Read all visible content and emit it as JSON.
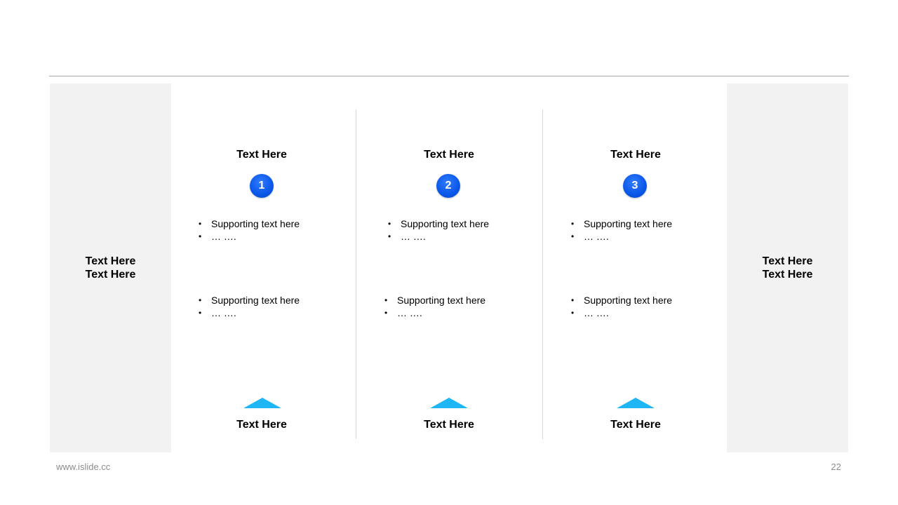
{
  "left_panel": {
    "line1": "Text Here",
    "line2": "Text Here"
  },
  "right_panel": {
    "line1": "Text Here",
    "line2": "Text Here"
  },
  "columns": [
    {
      "title": "Text Here",
      "number": "1",
      "group1": [
        "Supporting  text here",
        "… …."
      ],
      "group2": [
        "Supporting  text here",
        "… …."
      ],
      "footer": "Text Here"
    },
    {
      "title": "Text Here",
      "number": "2",
      "group1": [
        "Supporting  text here",
        "… …."
      ],
      "group2": [
        "Supporting  text here",
        "… …."
      ],
      "footer": "Text Here"
    },
    {
      "title": "Text Here",
      "number": "3",
      "group1": [
        "Supporting  text here",
        "… …."
      ],
      "group2": [
        "Supporting  text here",
        "… …."
      ],
      "footer": "Text Here"
    }
  ],
  "footer": {
    "url": "www.islide.cc",
    "page": "22"
  },
  "colors": {
    "badge": "#0a57e8",
    "triangle": "#1eb6f5",
    "panel": "#f2f2f2",
    "rule": "#a6a6a6"
  }
}
